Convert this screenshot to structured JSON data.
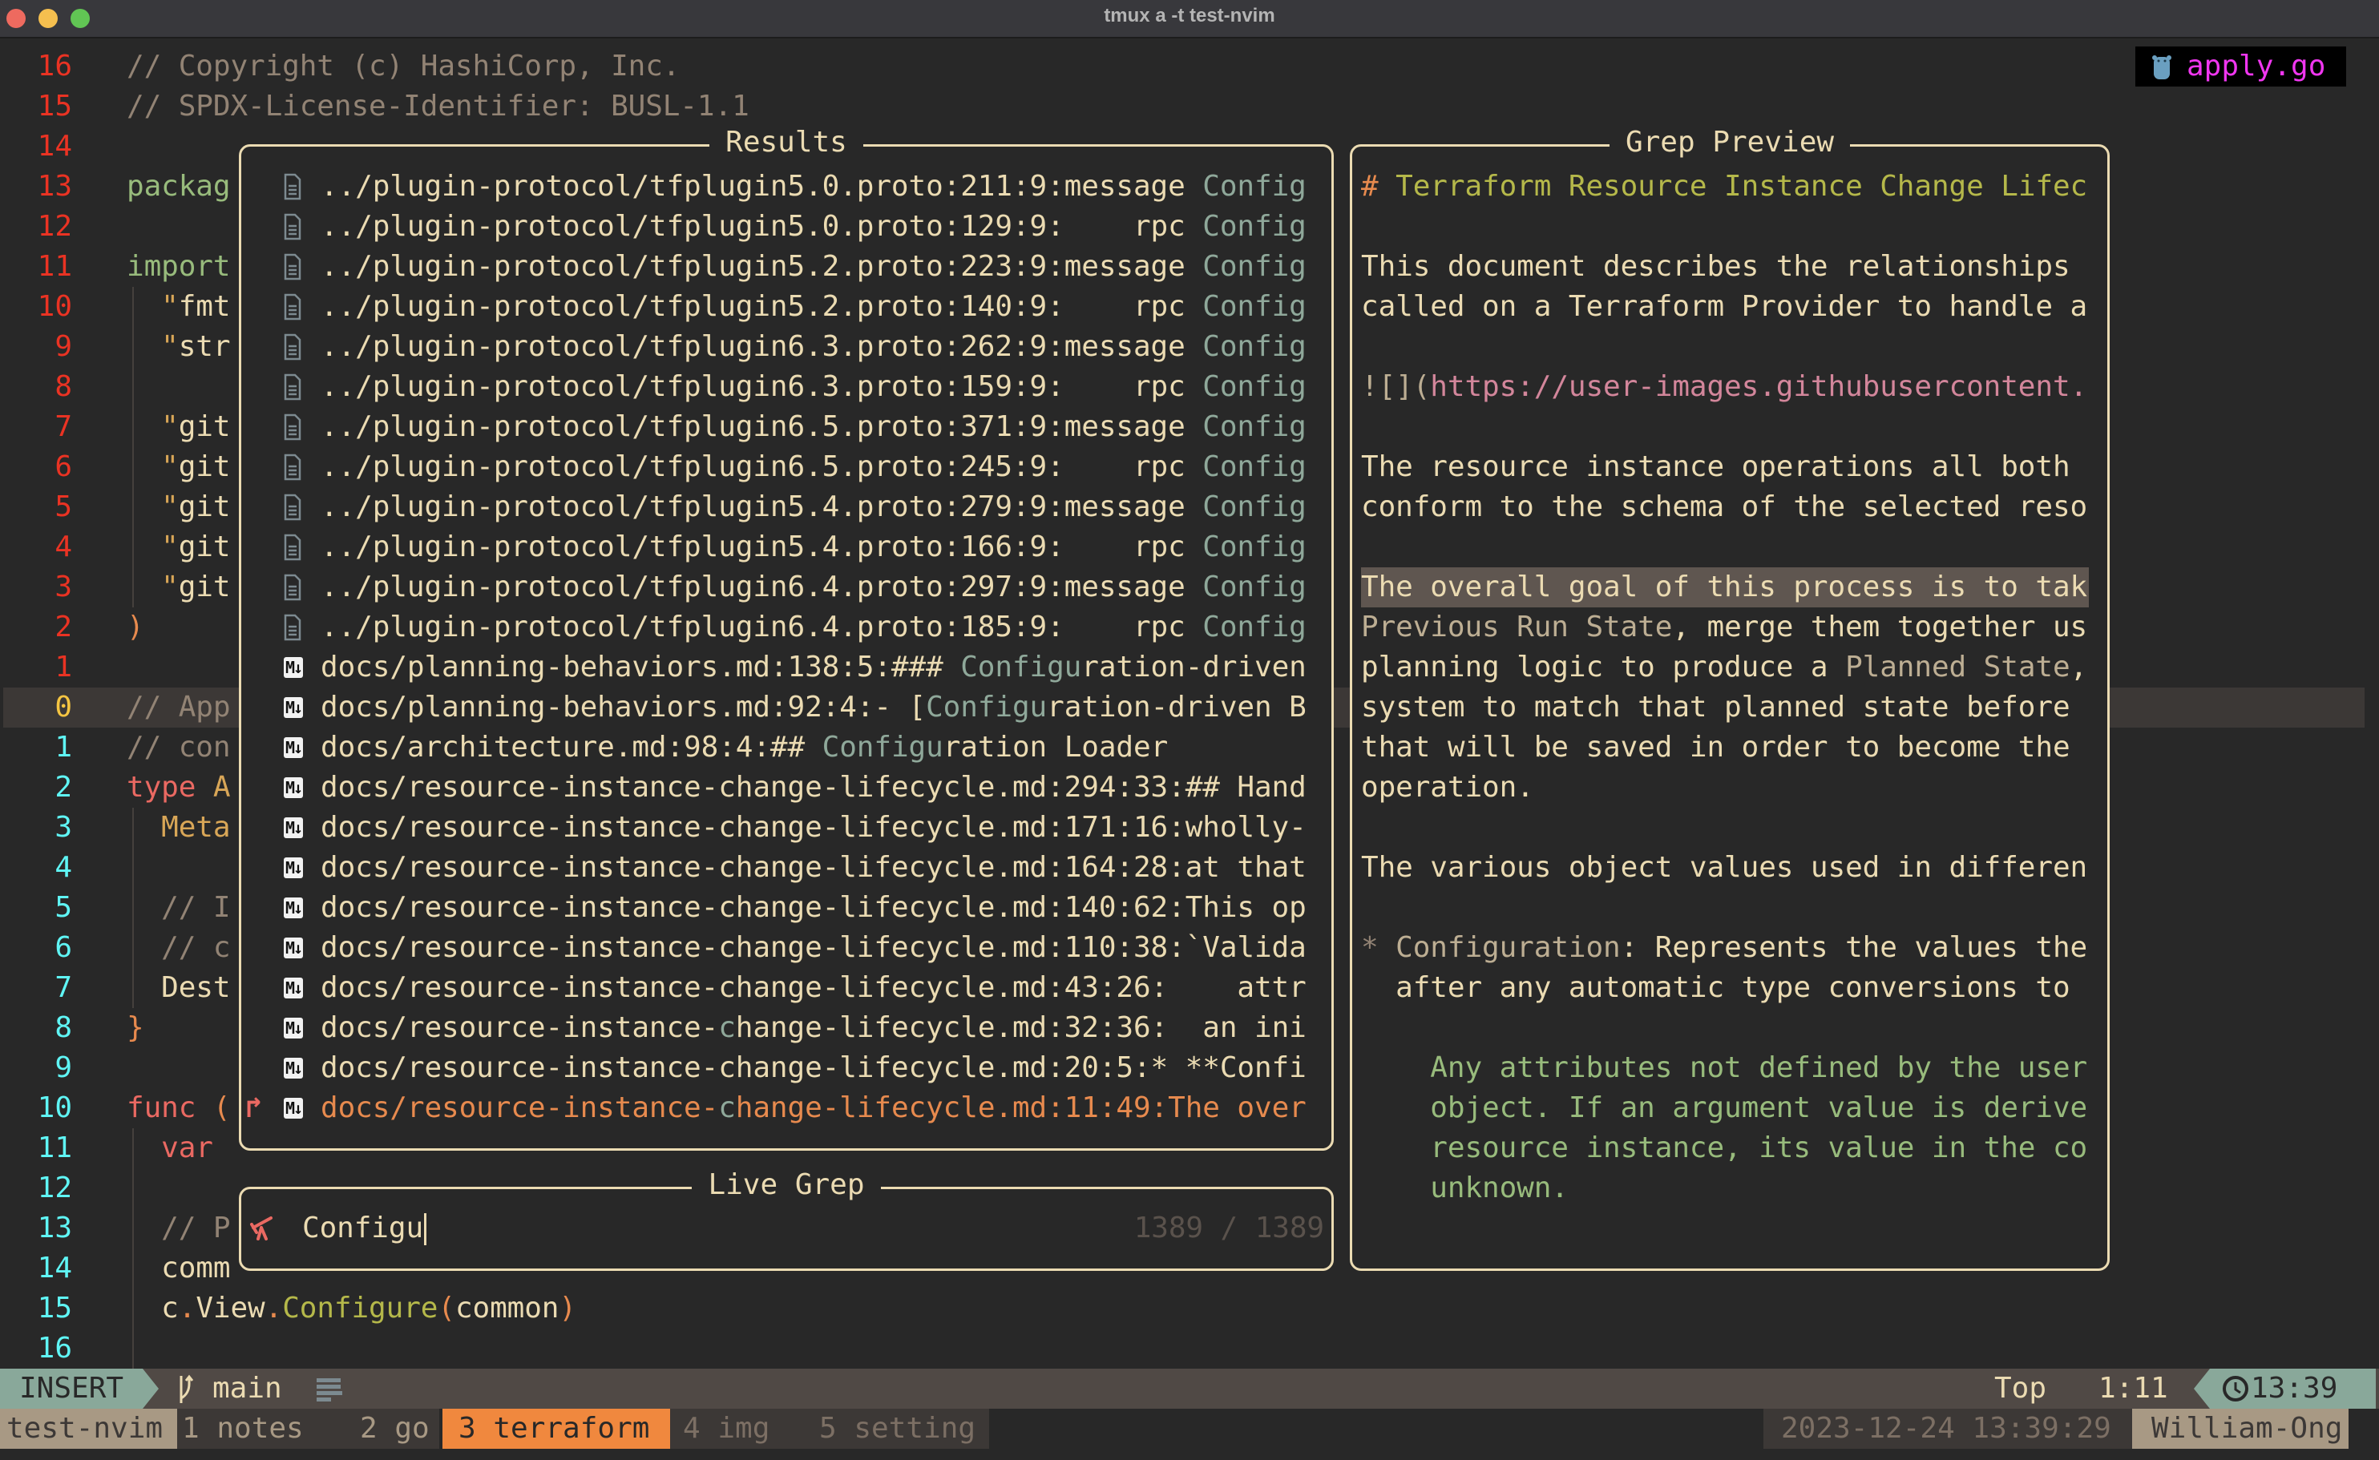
{
  "window": {
    "title": "tmux a -t test-nvim"
  },
  "colors": {
    "bg": "#282828",
    "fg": "#ebdbb2",
    "comment": "#928374",
    "red": "#ea6962",
    "orange": "#e78a4e",
    "yellow": "#d8a657",
    "green": "#98bb7c",
    "aqua": "#89a89a",
    "olive": "#b5b84a",
    "tan": "#bdae93",
    "pink": "#d3869b",
    "dim": "#5a524c",
    "match": "#8fa89a",
    "lnum_rel": "#ea3323",
    "lnum_cur": "#f5c542",
    "lnum_below": "#5ff5f5",
    "accent_tab": "#f0883e",
    "magenta": "#f036f0"
  },
  "editor": {
    "file_tag": {
      "icon": "gopher-icon",
      "name": "apply.go"
    },
    "line_numbers": [
      "16",
      "15",
      "14",
      "13",
      "12",
      "11",
      "10",
      "9",
      "8",
      "7",
      "6",
      "5",
      "4",
      "3",
      "2",
      "1",
      "0",
      "1",
      "2",
      "3",
      "4",
      "5",
      "6",
      "7",
      "8",
      "9",
      "10",
      "11",
      "12",
      "13",
      "14",
      "15",
      "16"
    ],
    "current_row": 16,
    "lines": [
      [
        [
          "// Copyright (c) HashiCorp, Inc.",
          "comment"
        ]
      ],
      [
        [
          "// SPDX-License-Identifier: BUSL-1.1",
          "comment"
        ]
      ],
      [],
      [
        [
          "packag",
          "green"
        ]
      ],
      [],
      [
        [
          "import",
          "green"
        ]
      ],
      [
        [
          "  \"",
          "yellow"
        ],
        [
          "fmt",
          "fg"
        ]
      ],
      [
        [
          "  \"",
          "yellow"
        ],
        [
          "str",
          "fg"
        ]
      ],
      [],
      [
        [
          "  \"",
          "yellow"
        ],
        [
          "git",
          "fg"
        ]
      ],
      [
        [
          "  \"",
          "yellow"
        ],
        [
          "git",
          "fg"
        ]
      ],
      [
        [
          "  \"",
          "yellow"
        ],
        [
          "git",
          "fg"
        ]
      ],
      [
        [
          "  \"",
          "yellow"
        ],
        [
          "git",
          "fg"
        ]
      ],
      [
        [
          "  \"",
          "yellow"
        ],
        [
          "git",
          "fg"
        ]
      ],
      [
        [
          ")",
          "orange"
        ]
      ],
      [],
      [
        [
          "// App",
          "comment"
        ]
      ],
      [
        [
          "// con",
          "comment"
        ]
      ],
      [
        [
          "type ",
          "red"
        ],
        [
          "A",
          "yellow"
        ]
      ],
      [
        [
          "  Meta",
          "yellow"
        ]
      ],
      [],
      [
        [
          "  // I",
          "comment"
        ]
      ],
      [
        [
          "  // c",
          "comment"
        ]
      ],
      [
        [
          "  Dest",
          "fg"
        ]
      ],
      [
        [
          "}",
          "orange"
        ]
      ],
      [],
      [
        [
          "func ",
          "red"
        ],
        [
          "(",
          "orange"
        ]
      ],
      [
        [
          "  var",
          "red"
        ]
      ],
      [],
      [
        [
          "  // P",
          "comment"
        ]
      ],
      [
        [
          "  comm",
          "fg"
        ]
      ],
      [
        [
          "  c",
          "fg"
        ],
        [
          ".",
          "orange"
        ],
        [
          "View",
          "fg"
        ],
        [
          ".",
          "orange"
        ],
        [
          "Configure",
          "olive"
        ],
        [
          "(",
          "orange"
        ],
        [
          "common",
          "fg"
        ],
        [
          ")",
          "orange"
        ]
      ],
      []
    ]
  },
  "results": {
    "title": "Results",
    "selected_index": 23,
    "items": [
      {
        "icon": "file-icon",
        "segments": [
          [
            "../plugin-protocol/tfplugin5.0.proto:211:9:message ",
            "fg"
          ],
          [
            "Config",
            "match"
          ]
        ]
      },
      {
        "icon": "file-icon",
        "segments": [
          [
            "../plugin-protocol/tfplugin5.0.proto:129:9:    rpc ",
            "fg"
          ],
          [
            "Config",
            "match"
          ]
        ]
      },
      {
        "icon": "file-icon",
        "segments": [
          [
            "../plugin-protocol/tfplugin5.2.proto:223:9:message ",
            "fg"
          ],
          [
            "Config",
            "match"
          ]
        ]
      },
      {
        "icon": "file-icon",
        "segments": [
          [
            "../plugin-protocol/tfplugin5.2.proto:140:9:    rpc ",
            "fg"
          ],
          [
            "Config",
            "match"
          ]
        ]
      },
      {
        "icon": "file-icon",
        "segments": [
          [
            "../plugin-protocol/tfplugin6.3.proto:262:9:message ",
            "fg"
          ],
          [
            "Config",
            "match"
          ]
        ]
      },
      {
        "icon": "file-icon",
        "segments": [
          [
            "../plugin-protocol/tfplugin6.3.proto:159:9:    rpc ",
            "fg"
          ],
          [
            "Config",
            "match"
          ]
        ]
      },
      {
        "icon": "file-icon",
        "segments": [
          [
            "../plugin-protocol/tfplugin6.5.proto:371:9:message ",
            "fg"
          ],
          [
            "Config",
            "match"
          ]
        ]
      },
      {
        "icon": "file-icon",
        "segments": [
          [
            "../plugin-protocol/tfplugin6.5.proto:245:9:    rpc ",
            "fg"
          ],
          [
            "Config",
            "match"
          ]
        ]
      },
      {
        "icon": "file-icon",
        "segments": [
          [
            "../plugin-protocol/tfplugin5.4.proto:279:9:message ",
            "fg"
          ],
          [
            "Config",
            "match"
          ]
        ]
      },
      {
        "icon": "file-icon",
        "segments": [
          [
            "../plugin-protocol/tfplugin5.4.proto:166:9:    rpc ",
            "fg"
          ],
          [
            "Config",
            "match"
          ]
        ]
      },
      {
        "icon": "file-icon",
        "segments": [
          [
            "../plugin-protocol/tfplugin6.4.proto:297:9:message ",
            "fg"
          ],
          [
            "Config",
            "match"
          ]
        ]
      },
      {
        "icon": "file-icon",
        "segments": [
          [
            "../plugin-protocol/tfplugin6.4.proto:185:9:    rpc ",
            "fg"
          ],
          [
            "Config",
            "match"
          ]
        ]
      },
      {
        "icon": "markdown-icon",
        "segments": [
          [
            "docs/planning-behaviors.md:138:5:### ",
            "fg"
          ],
          [
            "Configu",
            "match"
          ],
          [
            "ration-driven",
            "fg"
          ]
        ]
      },
      {
        "icon": "markdown-icon",
        "segments": [
          [
            "docs/planning-behaviors.md:92:4:- [",
            "fg"
          ],
          [
            "Configu",
            "match"
          ],
          [
            "ration-driven B",
            "fg"
          ]
        ]
      },
      {
        "icon": "markdown-icon",
        "segments": [
          [
            "docs/architecture.md:98:4:## ",
            "fg"
          ],
          [
            "Configu",
            "match"
          ],
          [
            "ration Loader",
            "fg"
          ]
        ]
      },
      {
        "icon": "markdown-icon",
        "segments": [
          [
            "docs/resource-instance-change-lifecycle.md:294:33:## Hand",
            "fg"
          ]
        ]
      },
      {
        "icon": "markdown-icon",
        "segments": [
          [
            "docs/resource-instance-change-lifecycle.md:171:16:wholly-",
            "fg"
          ]
        ]
      },
      {
        "icon": "markdown-icon",
        "segments": [
          [
            "docs/resource-instance-change-lifecycle.md:164:28:at that",
            "fg"
          ]
        ]
      },
      {
        "icon": "markdown-icon",
        "segments": [
          [
            "docs/resource-instance-change-lifecycle.md:140:62:This op",
            "fg"
          ]
        ]
      },
      {
        "icon": "markdown-icon",
        "segments": [
          [
            "docs/resource-instance-change-lifecycle.md:110:38:`Valida",
            "fg"
          ]
        ]
      },
      {
        "icon": "markdown-icon",
        "segments": [
          [
            "docs/resource-instance-change-lifecycle.md:43:26:    attr",
            "fg"
          ]
        ]
      },
      {
        "icon": "markdown-icon",
        "segments": [
          [
            "docs/resource-instance-",
            "fg"
          ],
          [
            "c",
            "match"
          ],
          [
            "hange-lifecycle.md:32:36:  an ini",
            "fg"
          ]
        ]
      },
      {
        "icon": "markdown-icon",
        "segments": [
          [
            "docs/resource-instance-change-lifecycle.md:20:5:* **Confi",
            "fg"
          ]
        ]
      },
      {
        "icon": "markdown-icon",
        "segments": [
          [
            "docs/resource-instance-",
            "orange"
          ],
          [
            "c",
            "match"
          ],
          [
            "hange-lifecycle.md:11:49:The over",
            "orange"
          ]
        ]
      }
    ]
  },
  "prompt": {
    "title": "Live Grep",
    "icon": "telescope-icon",
    "value": "Configu",
    "count": "1389 / 1389"
  },
  "preview": {
    "title": "Grep Preview",
    "highlight_row": 10,
    "lines": [
      [
        [
          "# ",
          "orange"
        ],
        [
          "Terraform Resource Instance Change Lifec",
          "olive"
        ]
      ],
      [],
      [
        [
          "This document describes the relationships",
          "fg"
        ]
      ],
      [
        [
          "called on a Terraform Provider to handle a",
          "fg"
        ]
      ],
      [],
      [
        [
          "![](",
          "tan"
        ],
        [
          "https://user-images.githubusercontent.",
          "pink"
        ]
      ],
      [],
      [
        [
          "The resource instance operations all both",
          "fg"
        ]
      ],
      [
        [
          "conform to the schema of the selected reso",
          "fg"
        ]
      ],
      [],
      [
        [
          "The overall goal of this process is to tak",
          "fg"
        ]
      ],
      [
        [
          "Previous Run State",
          "tan"
        ],
        [
          ", merge them together us",
          "fg"
        ]
      ],
      [
        [
          "planning logic to produce a ",
          "fg"
        ],
        [
          "Planned State",
          "tan"
        ],
        [
          ",",
          "fg"
        ]
      ],
      [
        [
          "system to match that planned state before",
          "fg"
        ]
      ],
      [
        [
          "that will be saved in order to become the",
          "fg"
        ]
      ],
      [
        [
          "operation.",
          "fg"
        ]
      ],
      [],
      [
        [
          "The various object values used in differen",
          "fg"
        ]
      ],
      [],
      [
        [
          "* ",
          "comment"
        ],
        [
          "Configuration",
          "tan"
        ],
        [
          ": Represents the values the",
          "fg"
        ]
      ],
      [
        [
          "  after any automatic type conversions to",
          "fg"
        ]
      ],
      [],
      [
        [
          "    Any attributes not defined by the user",
          "green"
        ]
      ],
      [
        [
          "    object. If an argument value is derive",
          "green"
        ]
      ],
      [
        [
          "    resource instance, its value in the co",
          "green"
        ]
      ],
      [
        [
          "    unknown.",
          "green"
        ]
      ]
    ]
  },
  "statusline": {
    "mode": "INSERT",
    "branch_icon": "git-branch-icon",
    "branch": "main",
    "list_icon": "list-icon",
    "position_label": "Top",
    "cursor": "1:11",
    "clock_icon": "clock-icon",
    "time": "13:39"
  },
  "tmux": {
    "session": "test-nvim",
    "windows": [
      {
        "label": "1 notes",
        "active": false
      },
      {
        "label": "2 go",
        "active": false
      },
      {
        "label": "3 terraform",
        "active": true
      },
      {
        "label": "4 img",
        "active": false
      },
      {
        "label": "5 setting",
        "active": false
      }
    ],
    "datetime": "2023-12-24 13:39:29",
    "user": "William-Ong"
  }
}
